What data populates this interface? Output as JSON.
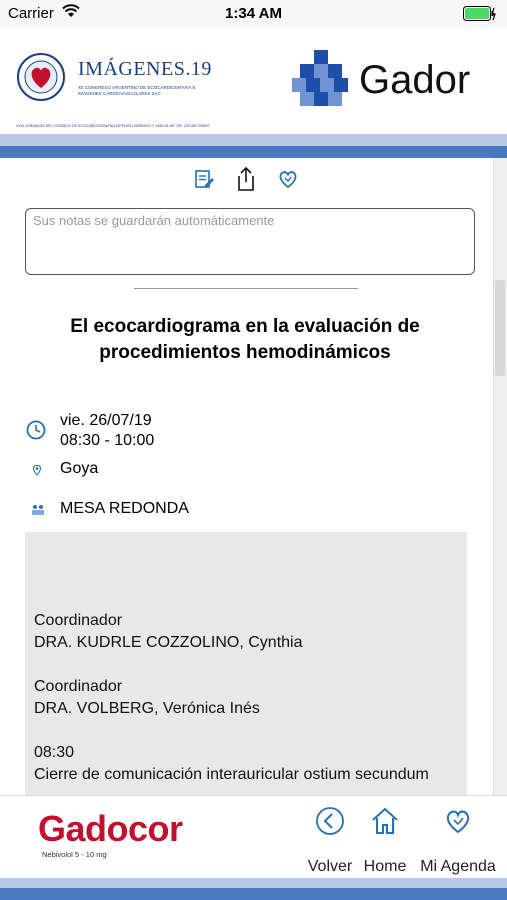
{
  "status_bar": {
    "carrier": "Carrier",
    "time": "1:34 AM"
  },
  "header": {
    "congress_logo": {
      "title": "IMÁGENES.19",
      "subtitle": "XII CONGRESO ARGENTINO DE ECOCARDIOGRAFÍA E IMÁGENES CARDIOVASCULARES SAC",
      "tagline": "XXVI JORNADAS DEL CONSEJO DE ECOCARDIOGRAFÍA DOPPLER CARDÍACO Y VASCULAR \"DR. OSCAR ORIAS\""
    },
    "sponsor_logo": {
      "brand": "Gador"
    }
  },
  "toolbar": {
    "icons": [
      "edit-icon",
      "share-icon",
      "favorite-heart-icon"
    ]
  },
  "notes": {
    "placeholder": "Sus notas se guardarán automáticamente"
  },
  "event": {
    "title": "El ecocardiograma en la evaluación de procedimientos hemodinámicos",
    "date": "vie. 26/07/19",
    "time": "08:30 - 10:00",
    "room": "Goya",
    "type": "MESA REDONDA"
  },
  "details": {
    "blocks": [
      {
        "role": "Coordinador",
        "name": "DRA. KUDRLE COZZOLINO, Cynthia"
      },
      {
        "role": "Coordinador",
        "name": "DRA. VOLBERG, Verónica Inés"
      },
      {
        "role": "08:30",
        "name": "Cierre de comunicación interauricular ostium secundum"
      }
    ]
  },
  "footer": {
    "brand": "Gadocor",
    "brand_sub": "Nebivolol 5 - 10 mg",
    "nav": [
      {
        "label": "Volver",
        "icon": "back-chevron-icon"
      },
      {
        "label": "Home",
        "icon": "home-icon"
      },
      {
        "label": "Mi Agenda",
        "icon": "agenda-heart-icon"
      }
    ]
  },
  "colors": {
    "accent_blue": "#4a79c1",
    "light_band": "#b8c8e6",
    "link_blue": "#2a6fb0",
    "gadocor_red": "#c3102e"
  }
}
